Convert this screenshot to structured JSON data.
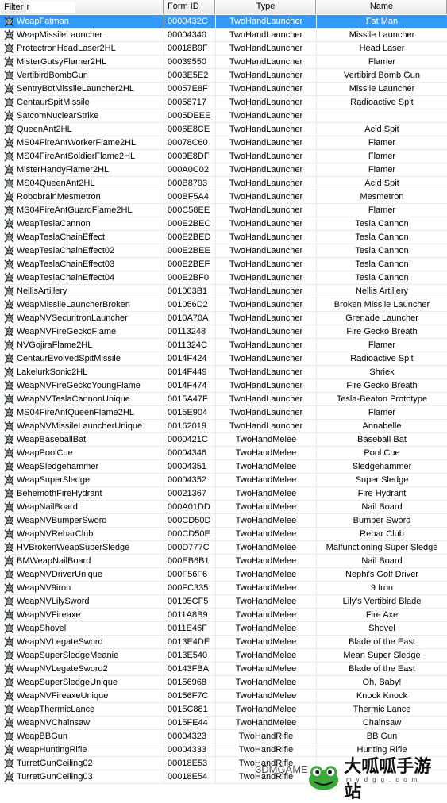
{
  "header": {
    "filter_label": "Filter",
    "filter_value": "r",
    "columns": [
      "Form ID",
      "Type",
      "Name"
    ]
  },
  "selected_index": 0,
  "colors": {
    "selection": "#3399ff",
    "header_bg": "#f0f0f0",
    "grid": "#ececec"
  },
  "row_icon": "weapon-skull-icon",
  "rows": [
    [
      "WeapFatman",
      "0000432C",
      "TwoHandLauncher",
      "Fat Man"
    ],
    [
      "WeapMissileLauncher",
      "00004340",
      "TwoHandLauncher",
      "Missile Launcher"
    ],
    [
      "ProtectronHeadLaser2HL",
      "00018B9F",
      "TwoHandLauncher",
      "Head Laser"
    ],
    [
      "MisterGutsyFlamer2HL",
      "00039550",
      "TwoHandLauncher",
      "Flamer"
    ],
    [
      "VertibirdBombGun",
      "0003E5E2",
      "TwoHandLauncher",
      "Vertibird Bomb Gun"
    ],
    [
      "SentryBotMissileLauncher2HL",
      "00057E8F",
      "TwoHandLauncher",
      "Missile Launcher"
    ],
    [
      "CentaurSpitMissile",
      "00058717",
      "TwoHandLauncher",
      "Radioactive Spit"
    ],
    [
      "SatcomNuclearStrike",
      "0005DEEE",
      "TwoHandLauncher",
      ""
    ],
    [
      "QueenAnt2HL",
      "0006E8CE",
      "TwoHandLauncher",
      "Acid Spit"
    ],
    [
      "MS04FireAntWorkerFlame2HL",
      "00078C60",
      "TwoHandLauncher",
      "Flamer"
    ],
    [
      "MS04FireAntSoldierFlame2HL",
      "0009E8DF",
      "TwoHandLauncher",
      "Flamer"
    ],
    [
      "MisterHandyFlamer2HL",
      "000A0C02",
      "TwoHandLauncher",
      "Flamer"
    ],
    [
      "MS04QueenAnt2HL",
      "000B8793",
      "TwoHandLauncher",
      "Acid Spit"
    ],
    [
      "RobobrainMesmetron",
      "000BF5A4",
      "TwoHandLauncher",
      "Mesmetron"
    ],
    [
      "MS04FireAntGuardFlame2HL",
      "000C58EE",
      "TwoHandLauncher",
      "Flamer"
    ],
    [
      "WeapTeslaCannon",
      "000E2BEC",
      "TwoHandLauncher",
      "Tesla Cannon"
    ],
    [
      "WeapTeslaChainEffect",
      "000E2BED",
      "TwoHandLauncher",
      "Tesla Cannon"
    ],
    [
      "WeapTeslaChainEffect02",
      "000E2BEE",
      "TwoHandLauncher",
      "Tesla Cannon"
    ],
    [
      "WeapTeslaChainEffect03",
      "000E2BEF",
      "TwoHandLauncher",
      "Tesla Cannon"
    ],
    [
      "WeapTeslaChainEffect04",
      "000E2BF0",
      "TwoHandLauncher",
      "Tesla Cannon"
    ],
    [
      "NellisArtillery",
      "001003B1",
      "TwoHandLauncher",
      "Nellis Artillery"
    ],
    [
      "WeapMissileLauncherBroken",
      "001056D2",
      "TwoHandLauncher",
      "Broken Missile Launcher"
    ],
    [
      "WeapNVSecuritronLauncher",
      "0010A70A",
      "TwoHandLauncher",
      "Grenade Launcher"
    ],
    [
      "WeapNVFireGeckoFlame",
      "00113248",
      "TwoHandLauncher",
      "Fire Gecko Breath"
    ],
    [
      "NVGojiraFlame2HL",
      "0011324C",
      "TwoHandLauncher",
      "Flamer"
    ],
    [
      "CentaurEvolvedSpitMissile",
      "0014F424",
      "TwoHandLauncher",
      "Radioactive Spit"
    ],
    [
      "LakelurkSonic2HL",
      "0014F449",
      "TwoHandLauncher",
      "Shriek"
    ],
    [
      "WeapNVFireGeckoYoungFlame",
      "0014F474",
      "TwoHandLauncher",
      "Fire Gecko Breath"
    ],
    [
      "WeapNVTeslaCannonUnique",
      "0015A47F",
      "TwoHandLauncher",
      "Tesla-Beaton Prototype"
    ],
    [
      "MS04FireAntQueenFlame2HL",
      "0015E904",
      "TwoHandLauncher",
      "Flamer"
    ],
    [
      "WeapNVMissileLauncherUnique",
      "00162019",
      "TwoHandLauncher",
      "Annabelle"
    ],
    [
      "WeapBaseballBat",
      "0000421C",
      "TwoHandMelee",
      "Baseball Bat"
    ],
    [
      "WeapPoolCue",
      "00004346",
      "TwoHandMelee",
      "Pool Cue"
    ],
    [
      "WeapSledgehammer",
      "00004351",
      "TwoHandMelee",
      "Sledgehammer"
    ],
    [
      "WeapSuperSledge",
      "00004352",
      "TwoHandMelee",
      "Super Sledge"
    ],
    [
      "BehemothFireHydrant",
      "00021367",
      "TwoHandMelee",
      "Fire Hydrant"
    ],
    [
      "WeapNailBoard",
      "000A01DD",
      "TwoHandMelee",
      "Nail Board"
    ],
    [
      "WeapNVBumperSword",
      "000CD50D",
      "TwoHandMelee",
      "Bumper Sword"
    ],
    [
      "WeapNVRebarClub",
      "000CD50E",
      "TwoHandMelee",
      "Rebar Club"
    ],
    [
      "HVBrokenWeapSuperSledge",
      "000D777C",
      "TwoHandMelee",
      "Malfunctioning Super Sledge"
    ],
    [
      "BMWeapNailBoard",
      "000EB6B1",
      "TwoHandMelee",
      "Nail Board"
    ],
    [
      "WeapNVDriverUnique",
      "000F56F6",
      "TwoHandMelee",
      "Nephi's Golf Driver"
    ],
    [
      "WeapNV9iron",
      "000FC335",
      "TwoHandMelee",
      "9 Iron"
    ],
    [
      "WeapNVLilySword",
      "00105CF5",
      "TwoHandMelee",
      "Lily's Vertibird Blade"
    ],
    [
      "WeapNVFireaxe",
      "0011A8B9",
      "TwoHandMelee",
      "Fire Axe"
    ],
    [
      "WeapShovel",
      "0011E46F",
      "TwoHandMelee",
      "Shovel"
    ],
    [
      "WeapNVLegateSword",
      "0013E4DE",
      "TwoHandMelee",
      "Blade of the East"
    ],
    [
      "WeapSuperSledgeMeanie",
      "0013E540",
      "TwoHandMelee",
      "Mean Super Sledge"
    ],
    [
      "WeapNVLegateSword2",
      "00143FBA",
      "TwoHandMelee",
      "Blade of the East"
    ],
    [
      "WeapSuperSledgeUnique",
      "00156968",
      "TwoHandMelee",
      "Oh, Baby!"
    ],
    [
      "WeapNVFireaxeUnique",
      "00156F7C",
      "TwoHandMelee",
      "Knock Knock"
    ],
    [
      "WeapThermicLance",
      "0015C881",
      "TwoHandMelee",
      "Thermic Lance"
    ],
    [
      "WeapNVChainsaw",
      "0015FE44",
      "TwoHandMelee",
      "Chainsaw"
    ],
    [
      "WeapBBGun",
      "00004323",
      "TwoHandRifle",
      "BB Gun"
    ],
    [
      "WeapHuntingRifle",
      "00004333",
      "TwoHandRifle",
      "Hunting Rifle"
    ],
    [
      "TurretGunCeiling02",
      "00018E53",
      "TwoHandRifle",
      ""
    ],
    [
      "TurretGunCeiling03",
      "00018E54",
      "TwoHandRifle",
      ""
    ]
  ],
  "watermarks": {
    "left": "3DMGAME",
    "right": "大呱呱手游站",
    "url": "mydgg.com"
  }
}
